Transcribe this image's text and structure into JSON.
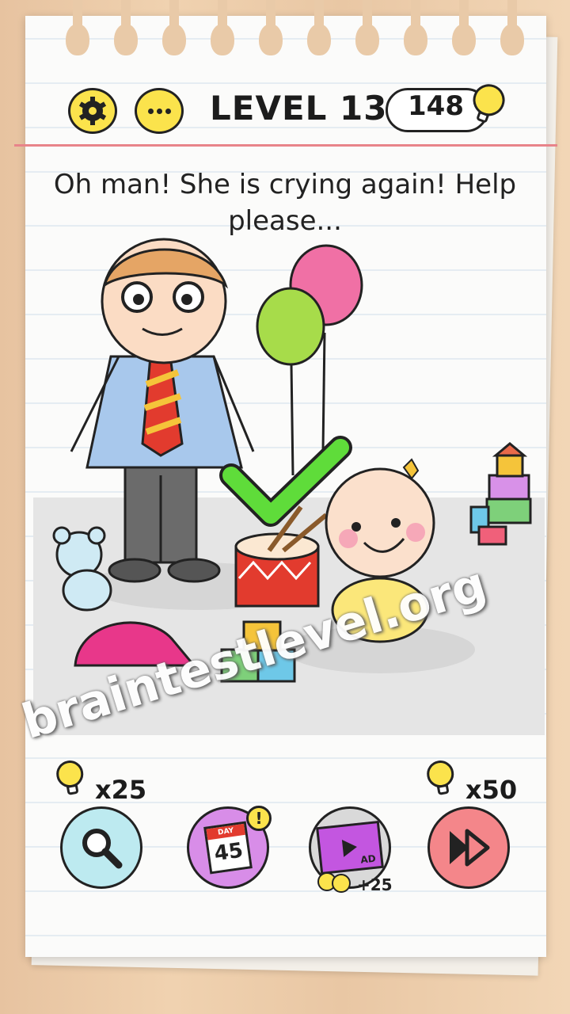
{
  "header": {
    "level_label": "LEVEL 139",
    "bulb_count": "148"
  },
  "question": {
    "text": "Oh man! She is crying again! Help please..."
  },
  "watermark": "braintestlevel.org",
  "hints": {
    "search_cost": "x25",
    "skip_cost": "x50",
    "ad_reward": "+25",
    "daily_day_label": "DAY",
    "daily_day_number": "45",
    "daily_badge": "!",
    "ad_label": "AD"
  },
  "icons": {
    "settings": "gear-icon",
    "menu": "more-dots-icon",
    "bulb": "lightbulb-icon",
    "search": "magnifier-icon",
    "calendar": "calendar-icon",
    "video": "film-icon",
    "skip": "fast-forward-icon"
  },
  "colors": {
    "accent_yellow": "#fbe34c",
    "search_bg": "#bdeaf0",
    "daily_bg": "#d88de8",
    "video_bg": "#d9d9d9",
    "skip_bg": "#f4868a",
    "check_green": "#5fdc3a"
  }
}
